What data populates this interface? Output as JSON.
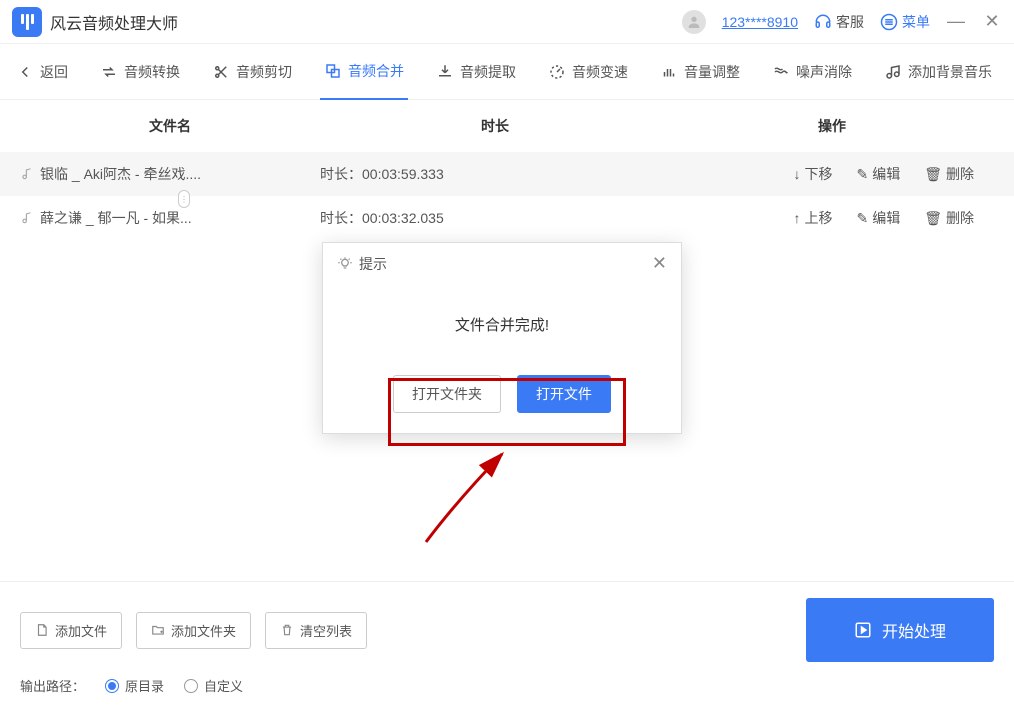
{
  "titlebar": {
    "app_name": "风云音频处理大师",
    "user_id": "123****8910",
    "support": "客服",
    "menu": "菜单"
  },
  "toolbar": {
    "back": "返回",
    "convert": "音频转换",
    "cut": "音频剪切",
    "merge": "音频合并",
    "extract": "音频提取",
    "speed": "音频变速",
    "volume": "音量调整",
    "noise": "噪声消除",
    "bgm": "添加背景音乐"
  },
  "table": {
    "headers": {
      "name": "文件名",
      "duration": "时长",
      "ops": "操作"
    },
    "duration_prefix": "时长：",
    "rows": [
      {
        "name": "银临 _ Aki阿杰 - 牵丝戏....",
        "duration": "00:03:59.333",
        "move": "下移",
        "move_dir": "down"
      },
      {
        "name": "薛之谦 _ 郁一凡 - 如果...",
        "duration": "00:03:32.035",
        "move": "上移",
        "move_dir": "up"
      }
    ],
    "op_edit": "编辑",
    "op_delete": "删除"
  },
  "dialog": {
    "title": "提示",
    "message": "文件合并完成!",
    "open_folder": "打开文件夹",
    "open_file": "打开文件"
  },
  "bottom": {
    "add_file": "添加文件",
    "add_folder": "添加文件夹",
    "clear_list": "清空列表",
    "start": "开始处理",
    "output_path": "输出路径：",
    "original_dir": "原目录",
    "custom": "自定义"
  }
}
